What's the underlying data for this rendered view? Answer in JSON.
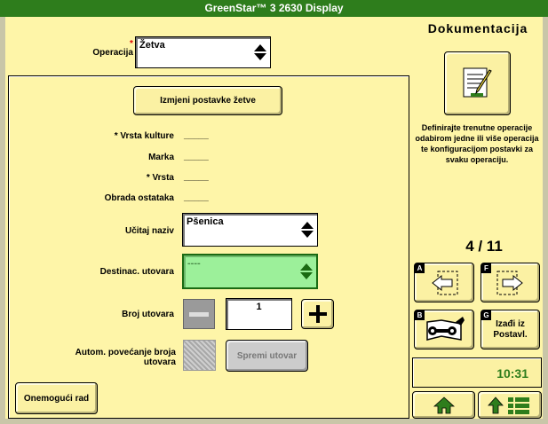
{
  "title": "GreenStar™ 3 2630 Display",
  "header": {
    "required_mark": "*",
    "operation_label": "Operacija",
    "operation_value": "Žetva"
  },
  "panel": {
    "edit_button": "Izmjeni postavke žetve",
    "rows": [
      {
        "label": "* Vrsta kulture",
        "value": "_____"
      },
      {
        "label": "Marka",
        "value": "_____"
      },
      {
        "label": "* Vrsta",
        "value": "_____"
      },
      {
        "label": "Obrada ostataka",
        "value": "_____"
      }
    ],
    "load_name_label": "Učitaj naziv",
    "load_name_value": "Pšenica",
    "destination_label": "Destinac. utovara",
    "destination_value": "----",
    "load_count_label": "Broj utovara",
    "load_count_value": "1",
    "auto_increment_label": "Autom. povećanje broja utovara",
    "save_load_button": "Spremi utovar",
    "disable_button": "Onemogući rad"
  },
  "side": {
    "heading": "Dokumentacija",
    "description": "Definirajte trenutne operacije odabirom jedne ili više operacija te konfiguracijom postavki za svaku operaciju.",
    "page": "4 / 11",
    "key_a": "A",
    "key_f": "F",
    "key_b": "B",
    "key_g": "G",
    "exit_label": "Izađi iz Postavl.",
    "clock": "10:31"
  },
  "colors": {
    "background": "#fef5a8",
    "title_bar": "#2e7d1c",
    "active_field": "#9cf09a",
    "clock_text": "#2e7d1c"
  }
}
